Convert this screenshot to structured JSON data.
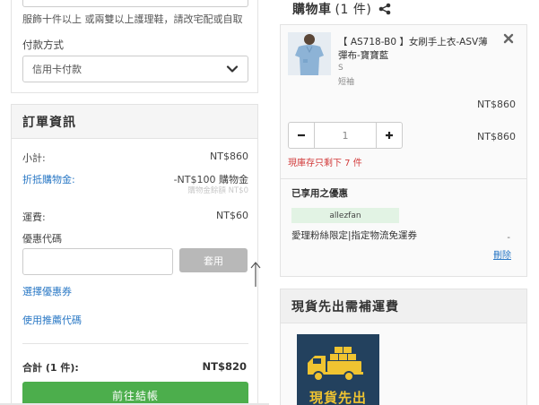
{
  "payment": {
    "note": "服飾十件以上 或兩雙以上護理鞋，請改宅配或自取",
    "method_label": "付款方式",
    "method_value": "信用卡付款"
  },
  "order": {
    "title": "訂單資訊",
    "subtotal_label": "小計:",
    "subtotal_value": "NT$860",
    "credit_label": "折抵購物金:",
    "credit_value": "-NT$100 購物金",
    "credit_balance": "購物金餘額 NT$0",
    "shipping_label": "運費:",
    "shipping_value": "NT$60",
    "coupon_label": "優惠代碼",
    "coupon_placeholder": "",
    "apply_label": "套用",
    "choose_coupon": "選擇優惠券",
    "referral_code": "使用推薦代碼",
    "total_label": "合計 (1 件):",
    "total_value": "NT$820",
    "checkout_label": "前往結帳"
  },
  "cart": {
    "title": "購物車",
    "count": "(1 件)",
    "item": {
      "name": "【 AS718-B0 】女刷手上衣-ASV薄彈布-寶寶藍",
      "size": "S",
      "sleeve": "短袖",
      "unit_price": "NT$860",
      "quantity": "1",
      "line_price": "NT$860",
      "stock_note": "現庫存只剩下 7 件"
    },
    "used_label": "已享用之優惠",
    "promo_tag": "allezfan",
    "promo_desc": "愛理粉絲限定|指定物流免運券",
    "promo_amount": "-",
    "delete_label": "刪除"
  },
  "shipping_notice": {
    "title": "現貨先出需補運費",
    "image_text": "現貨先出"
  },
  "colors": {
    "link": "#2a78c5",
    "checkout": "#4cae4c",
    "stock_warning": "#d23b3b",
    "promo_tag_bg": "#e2f3e4"
  },
  "icons": {
    "share": "share-icon",
    "remove": "close-icon",
    "select": "chevron-down-icon",
    "minus": "minus-icon",
    "plus": "plus-icon",
    "truck": "truck-icon"
  }
}
